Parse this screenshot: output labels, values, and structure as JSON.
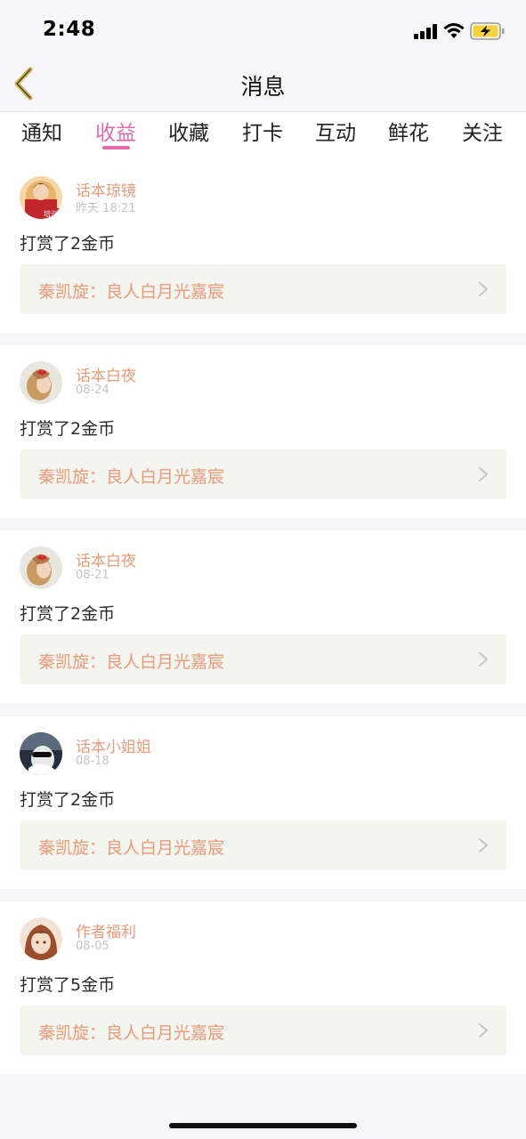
{
  "status_bar": {
    "time": "2:48",
    "signal_icon": "cellular-signal-icon",
    "wifi_icon": "wifi-icon",
    "battery_icon": "battery-charging-icon",
    "battery_color": "#f5d23a"
  },
  "nav": {
    "title": "消息",
    "back_icon": "chevron-left-icon",
    "back_color": "#c9b24a"
  },
  "tabs": [
    {
      "label": "通知",
      "active": false
    },
    {
      "label": "收益",
      "active": true
    },
    {
      "label": "收藏",
      "active": false
    },
    {
      "label": "打卡",
      "active": false
    },
    {
      "label": "互动",
      "active": false
    },
    {
      "label": "鲜花",
      "active": false
    },
    {
      "label": "关注",
      "active": false
    }
  ],
  "accent_color": "#e46aa9",
  "messages": [
    {
      "sender": "话本琼镜",
      "time": "昨天 18:21",
      "text": "打赏了2金币",
      "link": "秦凯旋：良人白月光嘉宸",
      "avatar_badge": "培训"
    },
    {
      "sender": "话本白夜",
      "time": "08-24",
      "text": "打赏了2金币",
      "link": "秦凯旋：良人白月光嘉宸"
    },
    {
      "sender": "话本白夜",
      "time": "08-21",
      "text": "打赏了2金币",
      "link": "秦凯旋：良人白月光嘉宸"
    },
    {
      "sender": "话本小姐姐",
      "time": "08-18",
      "text": "打赏了2金币",
      "link": "秦凯旋：良人白月光嘉宸"
    },
    {
      "sender": "作者福利",
      "time": "08-05",
      "text": "打赏了5金币",
      "link": "秦凯旋：良人白月光嘉宸"
    }
  ]
}
